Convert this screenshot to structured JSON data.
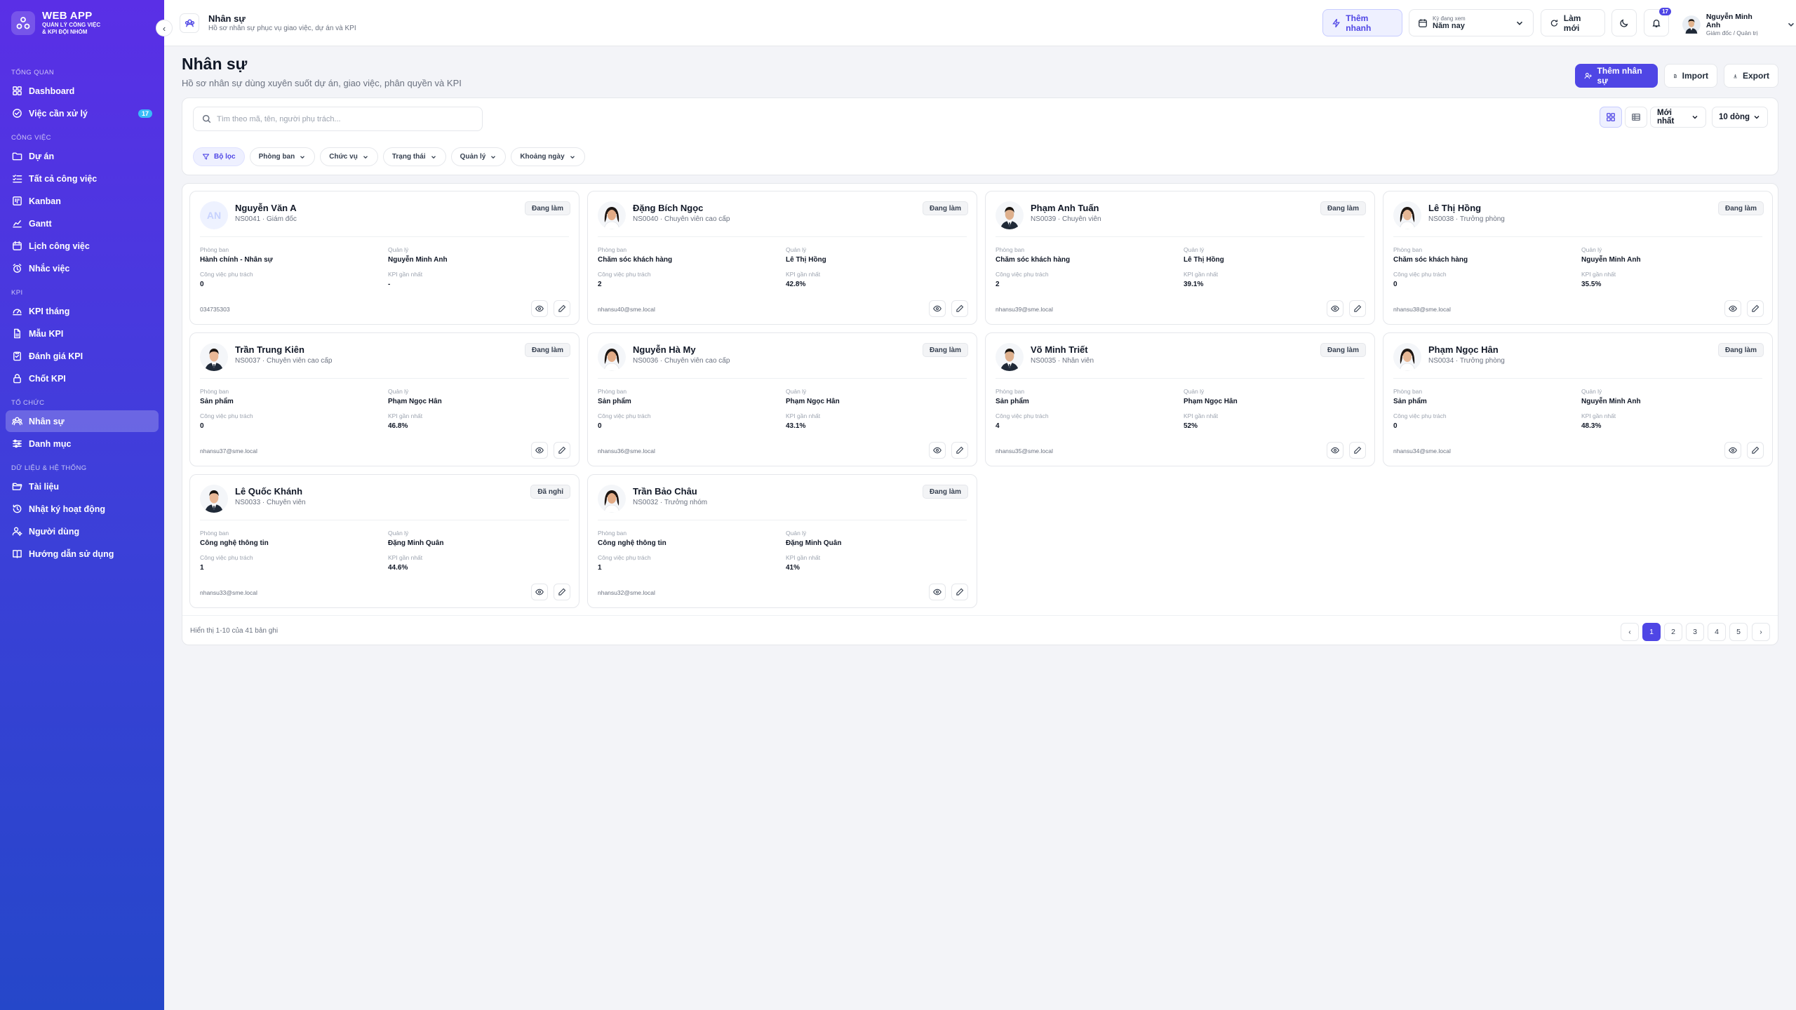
{
  "app": {
    "title": "WEB APP",
    "subtitle_1": "QUẢN LÝ CÔNG VIỆC",
    "subtitle_2": "& KPI ĐỘI NHÓM"
  },
  "sidebar": {
    "sections": [
      {
        "label": "TỔNG QUAN",
        "items": [
          {
            "label": "Dashboard",
            "icon": "dashboard-icon"
          },
          {
            "label": "Việc cần xử lý",
            "icon": "check-circle-icon",
            "badge": "17"
          }
        ]
      },
      {
        "label": "CÔNG VIỆC",
        "items": [
          {
            "label": "Dự án",
            "icon": "folder-icon"
          },
          {
            "label": "Tất cả công việc",
            "icon": "list-check-icon"
          },
          {
            "label": "Kanban",
            "icon": "kanban-icon"
          },
          {
            "label": "Gantt",
            "icon": "gantt-icon"
          },
          {
            "label": "Lịch công việc",
            "icon": "calendar-icon"
          },
          {
            "label": "Nhắc việc",
            "icon": "alarm-icon"
          }
        ]
      },
      {
        "label": "KPI",
        "items": [
          {
            "label": "KPI tháng",
            "icon": "gauge-icon"
          },
          {
            "label": "Mẫu KPI",
            "icon": "template-icon"
          },
          {
            "label": "Đánh giá KPI",
            "icon": "clipboard-icon"
          },
          {
            "label": "Chốt KPI",
            "icon": "lock-icon"
          }
        ]
      },
      {
        "label": "TỔ CHỨC",
        "items": [
          {
            "label": "Nhân sự",
            "icon": "users-icon",
            "active": true
          },
          {
            "label": "Danh mục",
            "icon": "sliders-icon"
          }
        ]
      },
      {
        "label": "DỮ LIỆU & HỆ THỐNG",
        "items": [
          {
            "label": "Tài liệu",
            "icon": "folder-open-icon"
          },
          {
            "label": "Nhật ký hoạt động",
            "icon": "history-icon"
          },
          {
            "label": "Người dùng",
            "icon": "user-cog-icon"
          },
          {
            "label": "Hướng dẫn sử dụng",
            "icon": "book-icon"
          }
        ]
      }
    ]
  },
  "topbar": {
    "title": "Nhân sự",
    "subtitle": "Hồ sơ nhân sự phục vụ giao việc, dự án và KPI",
    "quick_add": "Thêm nhanh",
    "period_label": "Kỳ đang xem",
    "period_value": "Năm nay",
    "refresh": "Làm mới",
    "notif_count": "17",
    "user_name": "Nguyễn Minh Anh",
    "user_role": "Giám đốc / Quản trị"
  },
  "page": {
    "title": "Nhân sự",
    "subtitle": "Hồ sơ nhân sự dùng xuyên suốt dự án, giao việc, phân quyền và KPI",
    "add_label": "Thêm nhân sự",
    "import_label": "Import",
    "export_label": "Export"
  },
  "filters": {
    "search_placeholder": "Tìm theo mã, tên, người phụ trách...",
    "sort": "Mới nhất",
    "page_size": "10 dòng",
    "chips": [
      "Bộ lọc",
      "Phòng ban",
      "Chức vụ",
      "Trạng thái",
      "Quản lý",
      "Khoảng ngày"
    ]
  },
  "labels": {
    "dept": "Phòng ban",
    "manager": "Quản lý",
    "tasks": "Công việc phụ trách",
    "kpi": "KPI gần nhất"
  },
  "employees": [
    {
      "name": "Nguyễn Văn A",
      "code_role": "NS0041 · Giám đốc",
      "status": "Đang làm",
      "dept": "Hành chính - Nhân sự",
      "manager": "Nguyễn Minh Anh",
      "tasks": "0",
      "kpi": "-",
      "contact": "034735303",
      "initials": "AN",
      "gender": "none"
    },
    {
      "name": "Đặng Bích Ngọc",
      "code_role": "NS0040 · Chuyên viên cao cấp",
      "status": "Đang làm",
      "dept": "Chăm sóc khách hàng",
      "manager": "Lê Thị Hồng",
      "tasks": "2",
      "kpi": "42.8%",
      "contact": "nhansu40@sme.local",
      "gender": "f"
    },
    {
      "name": "Phạm Anh Tuấn",
      "code_role": "NS0039 · Chuyên viên",
      "status": "Đang làm",
      "dept": "Chăm sóc khách hàng",
      "manager": "Lê Thị Hồng",
      "tasks": "2",
      "kpi": "39.1%",
      "contact": "nhansu39@sme.local",
      "gender": "m"
    },
    {
      "name": "Lê Thị Hồng",
      "code_role": "NS0038 · Trưởng phòng",
      "status": "Đang làm",
      "dept": "Chăm sóc khách hàng",
      "manager": "Nguyễn Minh Anh",
      "tasks": "0",
      "kpi": "35.5%",
      "contact": "nhansu38@sme.local",
      "gender": "f"
    },
    {
      "name": "Trần Trung Kiên",
      "code_role": "NS0037 · Chuyên viên cao cấp",
      "status": "Đang làm",
      "dept": "Sản phẩm",
      "manager": "Phạm Ngọc Hân",
      "tasks": "0",
      "kpi": "46.8%",
      "contact": "nhansu37@sme.local",
      "gender": "m"
    },
    {
      "name": "Nguyễn Hà My",
      "code_role": "NS0036 · Chuyên viên cao cấp",
      "status": "Đang làm",
      "dept": "Sản phẩm",
      "manager": "Phạm Ngọc Hân",
      "tasks": "0",
      "kpi": "43.1%",
      "contact": "nhansu36@sme.local",
      "gender": "f"
    },
    {
      "name": "Võ Minh Triết",
      "code_role": "NS0035 · Nhân viên",
      "status": "Đang làm",
      "dept": "Sản phẩm",
      "manager": "Phạm Ngọc Hân",
      "tasks": "4",
      "kpi": "52%",
      "contact": "nhansu35@sme.local",
      "gender": "m"
    },
    {
      "name": "Phạm Ngọc Hân",
      "code_role": "NS0034 · Trưởng phòng",
      "status": "Đang làm",
      "dept": "Sản phẩm",
      "manager": "Nguyễn Minh Anh",
      "tasks": "0",
      "kpi": "48.3%",
      "contact": "nhansu34@sme.local",
      "gender": "f"
    },
    {
      "name": "Lê Quốc Khánh",
      "code_role": "NS0033 · Chuyên viên",
      "status": "Đã nghỉ",
      "dept": "Công nghệ thông tin",
      "manager": "Đặng Minh Quân",
      "tasks": "1",
      "kpi": "44.6%",
      "contact": "nhansu33@sme.local",
      "gender": "m"
    },
    {
      "name": "Trần Bảo Châu",
      "code_role": "NS0032 · Trưởng nhóm",
      "status": "Đang làm",
      "dept": "Công nghệ thông tin",
      "manager": "Đặng Minh Quân",
      "tasks": "1",
      "kpi": "41%",
      "contact": "nhansu32@sme.local",
      "gender": "f"
    }
  ],
  "pagination": {
    "info": "Hiển thị 1-10 của 41 bản ghi",
    "pages": [
      "1",
      "2",
      "3",
      "4",
      "5"
    ],
    "current": "1"
  }
}
